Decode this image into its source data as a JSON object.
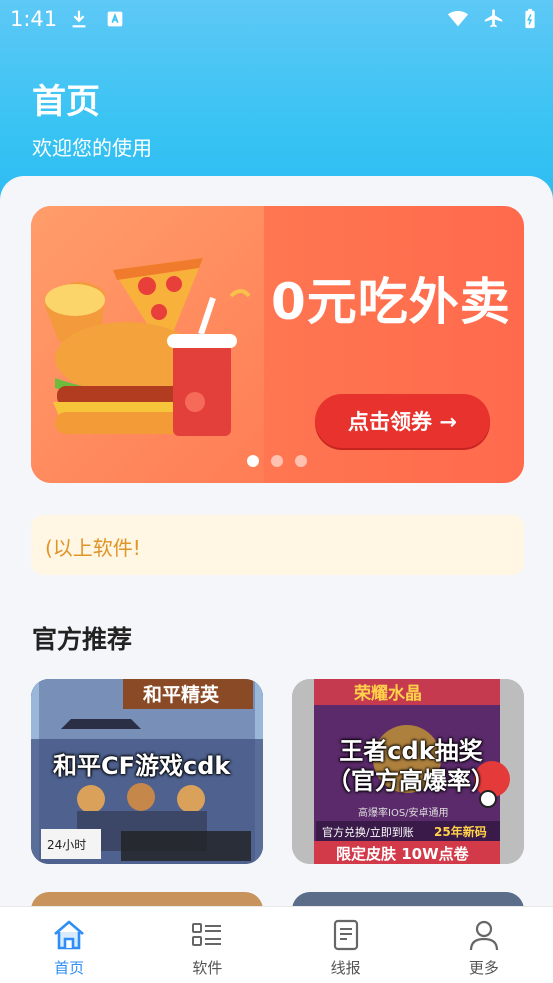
{
  "status_bar": {
    "time": "1:41",
    "left_icons": [
      "download-icon",
      "app-notification-icon"
    ],
    "right_icons": [
      "wifi-icon",
      "airplane-icon",
      "battery-icon"
    ]
  },
  "header": {
    "title": "首页",
    "subtitle": "欢迎您的使用"
  },
  "banner": {
    "headline": "0元吃外卖",
    "cta_label": "点击领券 →",
    "slide_count": 3,
    "active_slide": 1,
    "colors": {
      "background": "#ff7751",
      "cta": "#e8322d"
    }
  },
  "notice": {
    "text": "(以上软件!"
  },
  "section": {
    "title": "官方推荐"
  },
  "cards": [
    {
      "label": "和平CF游戏cdk",
      "image_text": [
        "和平精英",
        "24小时"
      ]
    },
    {
      "label": "王者cdk抽奖（官方高爆率）",
      "image_text": [
        "荣耀水晶",
        "高爆率IOS/安卓通用",
        "官方兑换/立即到账",
        "25年新码",
        "限定皮肤 10W点卷"
      ]
    }
  ],
  "tabbar": {
    "active": "home",
    "items": [
      {
        "id": "home",
        "label": "首页",
        "icon": "home-icon"
      },
      {
        "id": "software",
        "label": "软件",
        "icon": "list-icon"
      },
      {
        "id": "report",
        "label": "线报",
        "icon": "document-icon"
      },
      {
        "id": "more",
        "label": "更多",
        "icon": "user-icon"
      }
    ]
  },
  "colors": {
    "header_gradient_top": "#5ec8f6",
    "accent_blue": "#2f8ef5",
    "notice_text": "#e0952a"
  }
}
